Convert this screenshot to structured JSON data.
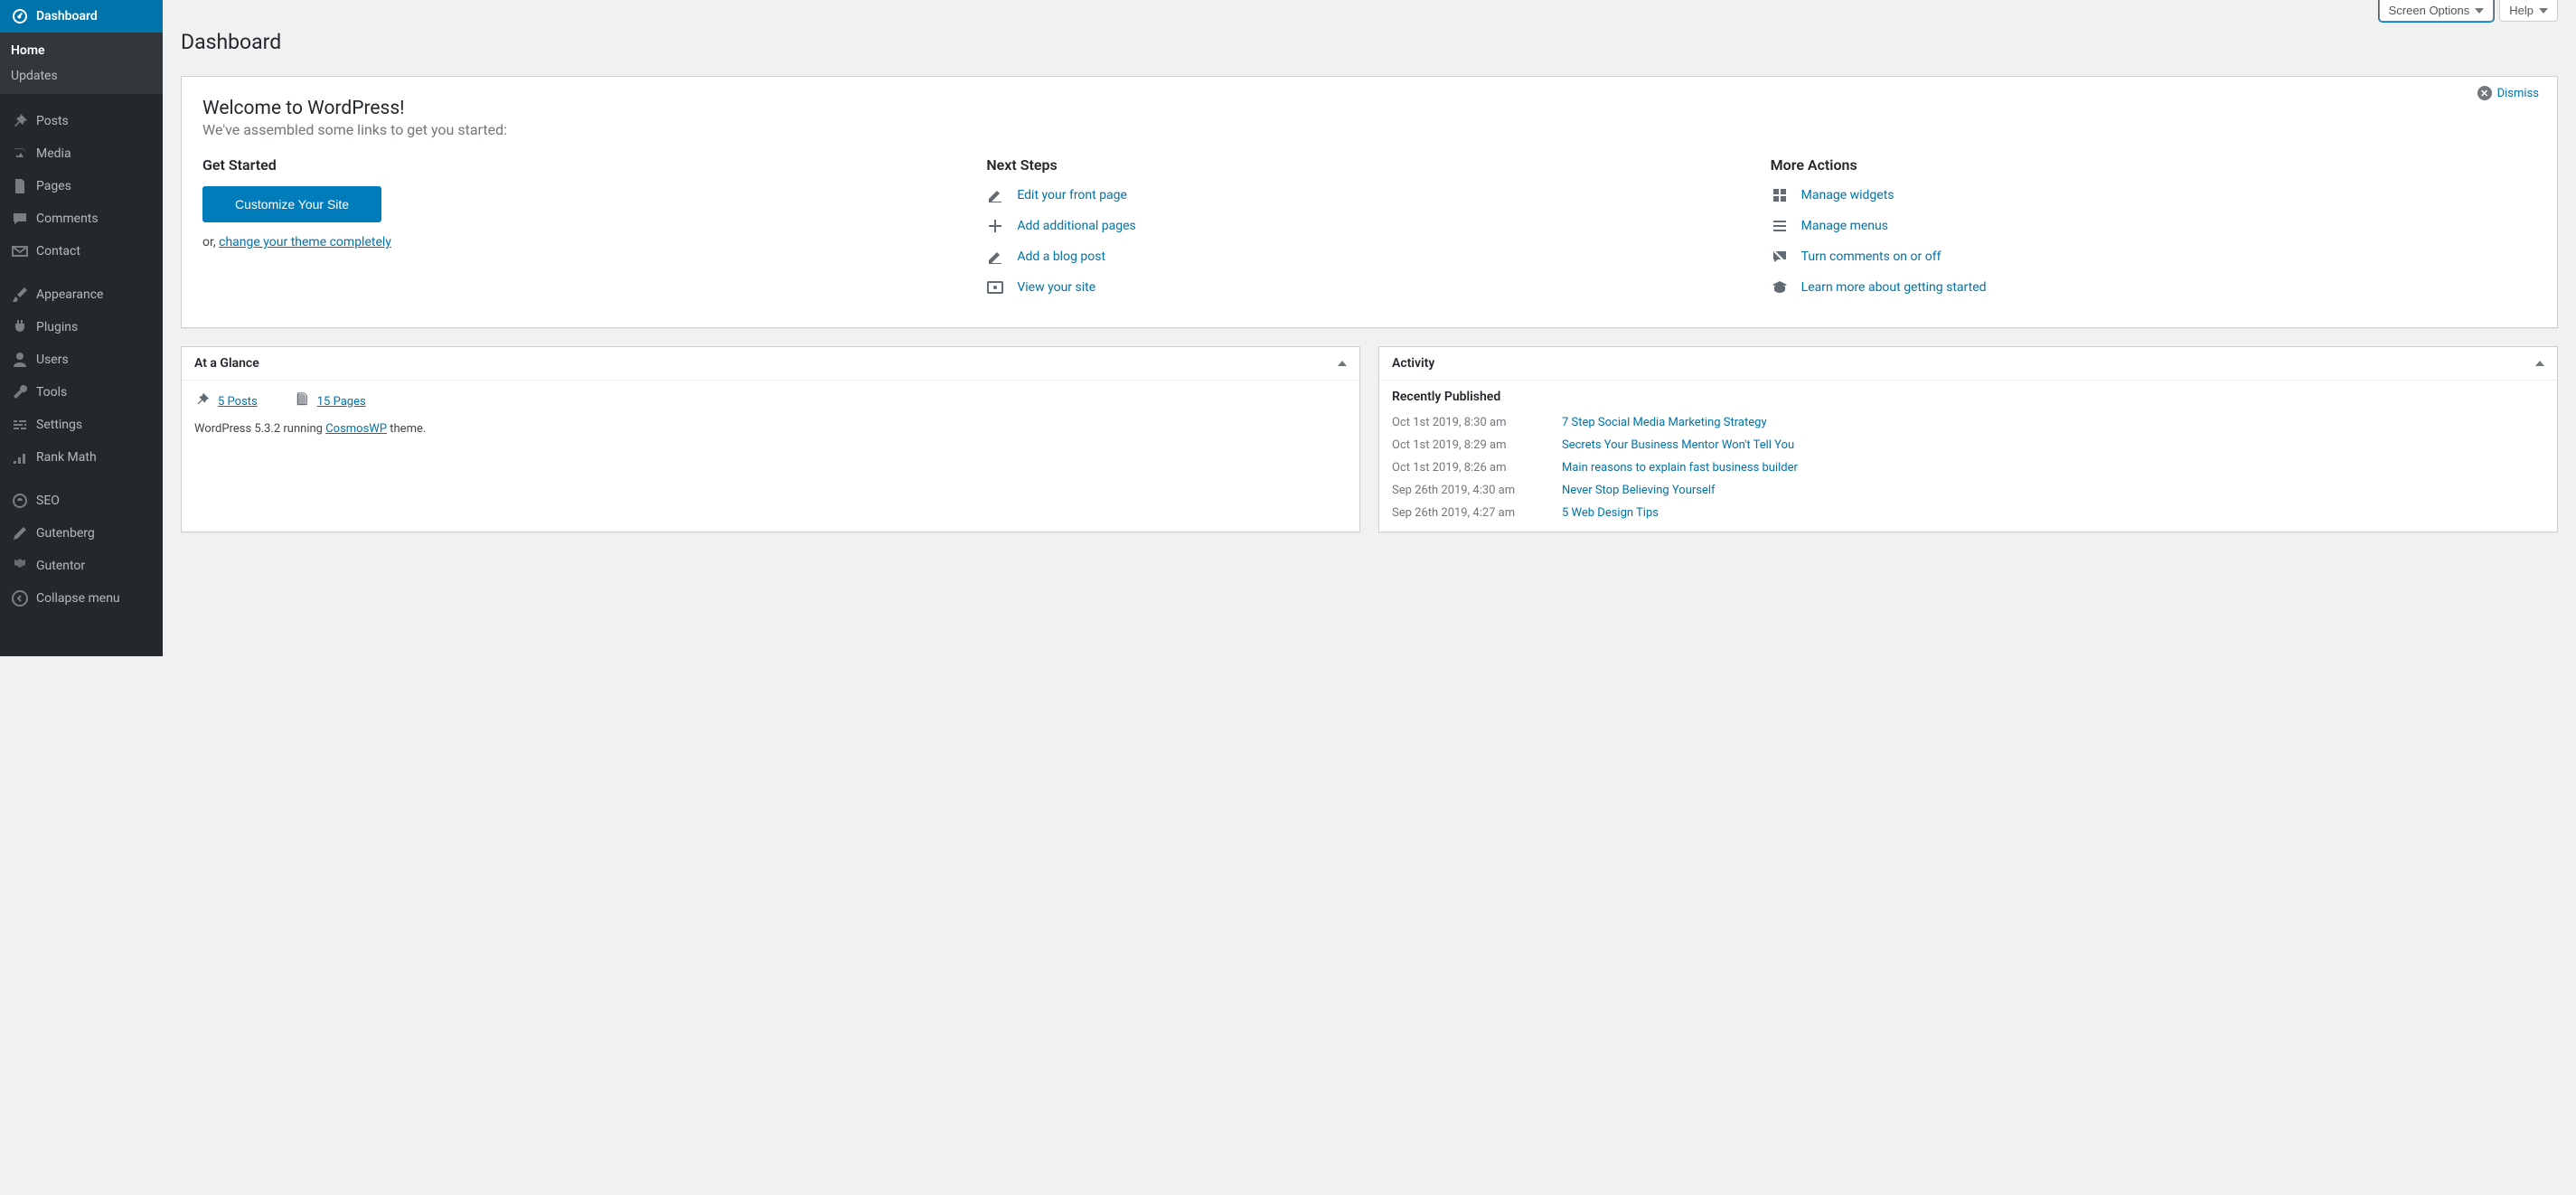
{
  "page_title": "Dashboard",
  "topbar": {
    "screen_options": "Screen Options",
    "help": "Help"
  },
  "sidebar": {
    "items": [
      {
        "label": "Dashboard",
        "icon": "dashboard"
      },
      {
        "label": "Posts",
        "icon": "pin"
      },
      {
        "label": "Media",
        "icon": "media"
      },
      {
        "label": "Pages",
        "icon": "page"
      },
      {
        "label": "Comments",
        "icon": "comment"
      },
      {
        "label": "Contact",
        "icon": "mail"
      },
      {
        "label": "Appearance",
        "icon": "brush"
      },
      {
        "label": "Plugins",
        "icon": "plug"
      },
      {
        "label": "Users",
        "icon": "user"
      },
      {
        "label": "Tools",
        "icon": "wrench"
      },
      {
        "label": "Settings",
        "icon": "sliders"
      },
      {
        "label": "Rank Math",
        "icon": "rank"
      },
      {
        "label": "SEO",
        "icon": "seo"
      },
      {
        "label": "Gutenberg",
        "icon": "pencil"
      },
      {
        "label": "Gutentor",
        "icon": "gutentor"
      },
      {
        "label": "Collapse menu",
        "icon": "collapse"
      }
    ],
    "submenu": [
      {
        "label": "Home",
        "active": true
      },
      {
        "label": "Updates",
        "active": false
      }
    ]
  },
  "welcome": {
    "title": "Welcome to WordPress!",
    "subtitle": "We've assembled some links to get you started:",
    "dismiss": "Dismiss",
    "get_started_heading": "Get Started",
    "customize_button": "Customize Your Site",
    "or_prefix": "or, ",
    "change_theme_link": "change your theme completely",
    "next_steps_heading": "Next Steps",
    "next_steps": [
      {
        "label": "Edit your front page",
        "icon": "edit"
      },
      {
        "label": "Add additional pages",
        "icon": "plus"
      },
      {
        "label": "Add a blog post",
        "icon": "edit"
      },
      {
        "label": "View your site",
        "icon": "view"
      }
    ],
    "more_actions_heading": "More Actions",
    "more_actions": [
      {
        "label": "Manage widgets",
        "icon": "widgets"
      },
      {
        "label": "Manage menus",
        "icon": "menus"
      },
      {
        "label": "Turn comments on or off",
        "icon": "comments-off"
      },
      {
        "label": "Learn more about getting started",
        "icon": "learn"
      }
    ]
  },
  "glance": {
    "heading": "At a Glance",
    "posts": "5 Posts",
    "pages": "15 Pages",
    "running_prefix": "WordPress 5.3.2 running ",
    "theme_name": "CosmosWP",
    "running_suffix": " theme."
  },
  "activity": {
    "heading": "Activity",
    "sub_heading": "Recently Published",
    "items": [
      {
        "date": "Oct 1st 2019, 8:30 am",
        "title": "7 Step Social Media Marketing Strategy"
      },
      {
        "date": "Oct 1st 2019, 8:29 am",
        "title": "Secrets Your Business Mentor Won't Tell You"
      },
      {
        "date": "Oct 1st 2019, 8:26 am",
        "title": "Main reasons to explain fast business builder"
      },
      {
        "date": "Sep 26th 2019, 4:30 am",
        "title": "Never Stop Believing Yourself"
      },
      {
        "date": "Sep 26th 2019, 4:27 am",
        "title": "5 Web Design Tips"
      }
    ]
  }
}
